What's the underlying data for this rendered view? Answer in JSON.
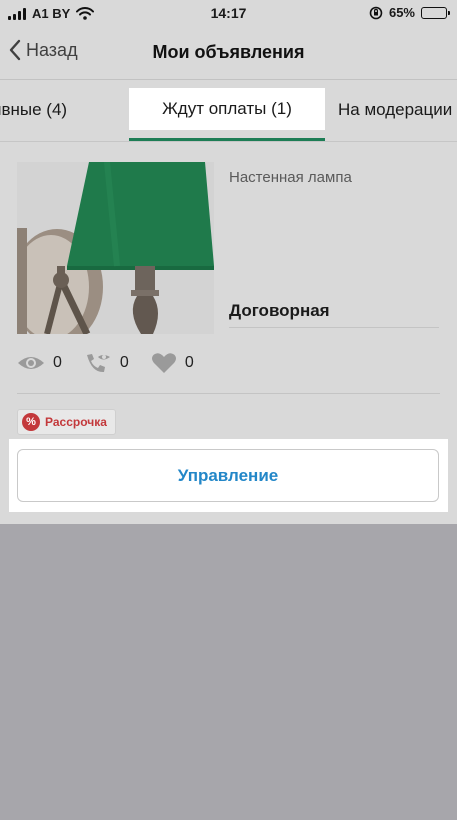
{
  "status_bar": {
    "carrier": "A1 BY",
    "time": "14:17",
    "battery": "65%",
    "battery_level": 0.65
  },
  "nav": {
    "back_label": "Назад",
    "title": "Мои объявления"
  },
  "tabs": [
    {
      "label": "ивные (4)",
      "active": false
    },
    {
      "label": "Ждут оплаты (1)",
      "active": true
    },
    {
      "label": "На модерации",
      "active": false
    }
  ],
  "listing": {
    "title": "Настенная лампа",
    "price": "Договорная",
    "stats": {
      "views": "0",
      "calls": "0",
      "likes": "0"
    },
    "installment_label": "Рассрочка",
    "installment_icon": "%"
  },
  "actions": {
    "manage_label": "Управление"
  },
  "colors": {
    "accent_green": "#1d7d55",
    "link_blue": "#2387c8",
    "installment_red": "#c3383b"
  }
}
